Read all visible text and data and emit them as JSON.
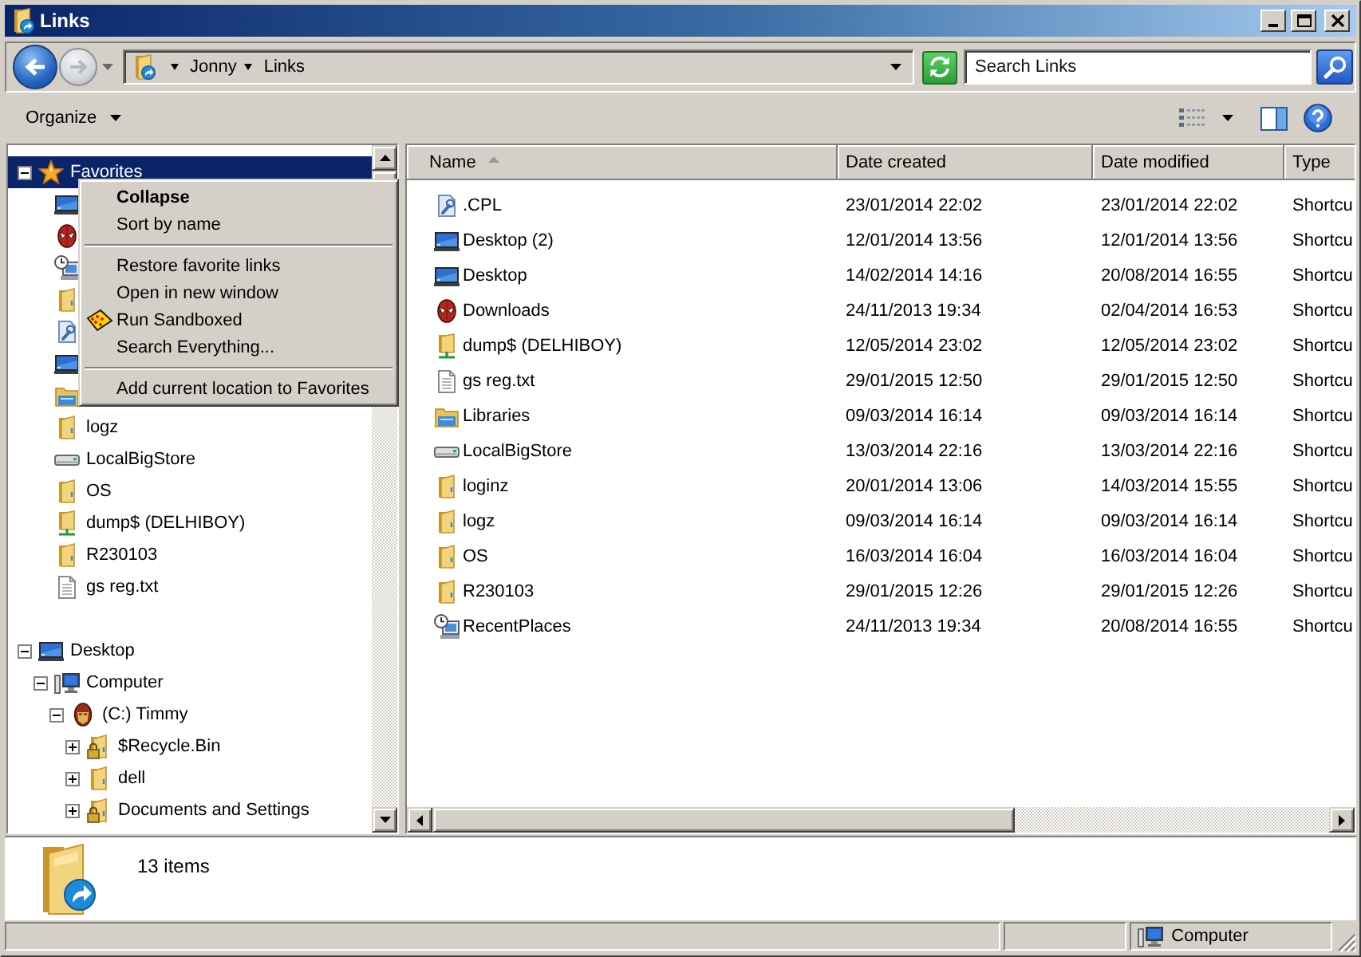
{
  "window": {
    "title": "Links"
  },
  "navigation": {
    "back": {
      "disabled": false
    },
    "forward": {
      "disabled": true
    }
  },
  "address_bar": {
    "crumbs": [
      "Jonny",
      "Links"
    ]
  },
  "search": {
    "placeholder": "Search Links"
  },
  "toolbar": {
    "organize": "Organize"
  },
  "nav_pane": {
    "favorites": {
      "kind": "favorites",
      "label": "Favorites",
      "expanded": true,
      "selected": true,
      "children": [
        {
          "kind": "desktop",
          "selected": false
        },
        {
          "kind": "downloads",
          "selected": false
        },
        {
          "kind": "recent",
          "selected": false
        },
        {
          "kind": "folder",
          "selected": false
        },
        {
          "kind": "control",
          "selected": false
        },
        {
          "kind": "desktop",
          "selected": false
        },
        {
          "kind": "libraries",
          "selected": false
        },
        {
          "kind": "folder",
          "label": "logz",
          "selected": false
        },
        {
          "kind": "drive",
          "label": "LocalBigStore",
          "selected": false
        },
        {
          "kind": "folder",
          "label": "OS",
          "selected": false
        },
        {
          "kind": "share",
          "label": "dump$ (DELHIBOY)",
          "selected": false
        },
        {
          "kind": "folder",
          "label": "R230103",
          "selected": false
        },
        {
          "kind": "text",
          "label": "gs reg.txt",
          "selected": false
        }
      ]
    },
    "tree": [
      {
        "kind": "desktop",
        "label": "Desktop",
        "expanded": true,
        "selected": false,
        "children": [
          {
            "kind": "computer",
            "label": "Computer",
            "expanded": true,
            "selected": false,
            "children": [
              {
                "kind": "system-drive",
                "label": "(C:) Timmy",
                "expanded": true,
                "selected": false,
                "children": [
                  {
                    "kind": "locked-folder",
                    "label": "$Recycle.Bin",
                    "expanded": false,
                    "selected": false
                  },
                  {
                    "kind": "folder",
                    "label": "dell",
                    "expanded": false,
                    "selected": false
                  },
                  {
                    "kind": "locked-folder",
                    "label": "Documents and Settings",
                    "expanded": false,
                    "selected": false
                  }
                ]
              }
            ]
          }
        ]
      }
    ]
  },
  "context_menu": {
    "items": [
      {
        "kind": "default",
        "label": "Collapse"
      },
      {
        "kind": "command",
        "label": "Sort by name"
      },
      {
        "kind": "separator"
      },
      {
        "kind": "command",
        "label": "Restore favorite links"
      },
      {
        "kind": "command",
        "label": "Open in new window"
      },
      {
        "kind": "command-icon",
        "label": "Run Sandboxed"
      },
      {
        "kind": "command",
        "label": "Search Everything..."
      },
      {
        "kind": "separator"
      },
      {
        "kind": "command",
        "label": "Add current location to Favorites"
      }
    ]
  },
  "file_list": {
    "columns": [
      {
        "label": "Name",
        "sorted": true
      },
      {
        "label": "Date created",
        "sorted": false
      },
      {
        "label": "Date modified",
        "sorted": false
      },
      {
        "label": "Type",
        "sorted": false
      }
    ],
    "rows": [
      {
        "kind": "control",
        "name": ".CPL",
        "date_created": "23/01/2014 22:02",
        "date_modified": "23/01/2014 22:02",
        "type": "Shortcu",
        "selected": false
      },
      {
        "kind": "desktop",
        "name": "Desktop (2)",
        "date_created": "12/01/2014 13:56",
        "date_modified": "12/01/2014 13:56",
        "type": "Shortcu",
        "selected": false
      },
      {
        "kind": "desktop",
        "name": "Desktop",
        "date_created": "14/02/2014 14:16",
        "date_modified": "20/08/2014 16:55",
        "type": "Shortcu",
        "selected": false
      },
      {
        "kind": "downloads",
        "name": "Downloads",
        "date_created": "24/11/2013 19:34",
        "date_modified": "02/04/2014 16:53",
        "type": "Shortcu",
        "selected": false
      },
      {
        "kind": "share",
        "name": "dump$ (DELHIBOY)",
        "date_created": "12/05/2014 23:02",
        "date_modified": "12/05/2014 23:02",
        "type": "Shortcu",
        "selected": false
      },
      {
        "kind": "text",
        "name": "gs reg.txt",
        "date_created": "29/01/2015 12:50",
        "date_modified": "29/01/2015 12:50",
        "type": "Shortcu",
        "selected": false
      },
      {
        "kind": "libraries",
        "name": "Libraries",
        "date_created": "09/03/2014 16:14",
        "date_modified": "09/03/2014 16:14",
        "type": "Shortcu",
        "selected": false
      },
      {
        "kind": "drive",
        "name": "LocalBigStore",
        "date_created": "13/03/2014 22:16",
        "date_modified": "13/03/2014 22:16",
        "type": "Shortcu",
        "selected": false
      },
      {
        "kind": "folder",
        "name": "loginz",
        "date_created": "20/01/2014 13:06",
        "date_modified": "14/03/2014 15:55",
        "type": "Shortcu",
        "selected": false
      },
      {
        "kind": "folder",
        "name": "logz",
        "date_created": "09/03/2014 16:14",
        "date_modified": "09/03/2014 16:14",
        "type": "Shortcu",
        "selected": false
      },
      {
        "kind": "folder",
        "name": "OS",
        "date_created": "16/03/2014 16:04",
        "date_modified": "16/03/2014 16:04",
        "type": "Shortcu",
        "selected": false
      },
      {
        "kind": "folder",
        "name": "R230103",
        "date_created": "29/01/2015 12:26",
        "date_modified": "29/01/2015 12:26",
        "type": "Shortcu",
        "selected": false
      },
      {
        "kind": "recent",
        "name": "RecentPlaces",
        "date_created": "24/11/2013 19:34",
        "date_modified": "20/08/2014 16:55",
        "type": "Shortcu",
        "selected": false
      }
    ]
  },
  "details_pane": {
    "summary": "13 items"
  },
  "status_bar": {
    "location": "Computer"
  }
}
